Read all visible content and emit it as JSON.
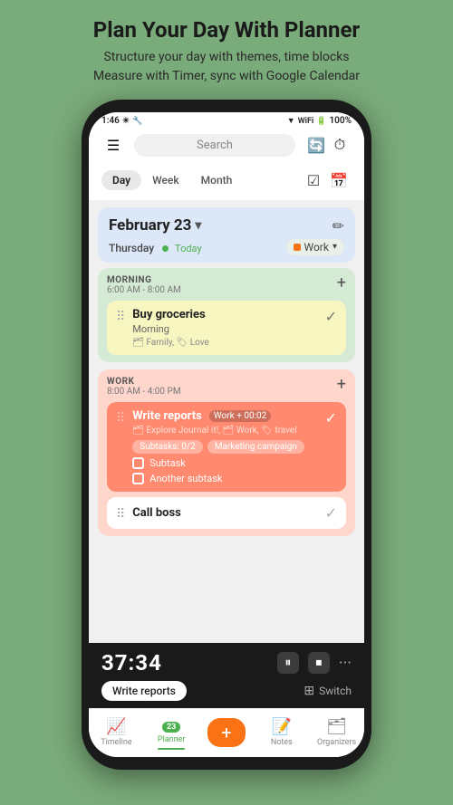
{
  "header": {
    "title": "Plan Your Day With Planner",
    "subtitle_line1": "Structure your day with themes, time blocks",
    "subtitle_line2": "Measure with Timer, sync with Google Calendar"
  },
  "status_bar": {
    "time": "1:46",
    "battery": "100%",
    "signal": "●●●"
  },
  "search": {
    "placeholder": "Search"
  },
  "view_tabs": {
    "day": "Day",
    "week": "Week",
    "month": "Month"
  },
  "date_header": {
    "date": "February 23",
    "day": "Thursday",
    "today_label": "Today",
    "work_label": "Work"
  },
  "morning_section": {
    "title": "MORNING",
    "time": "6:00 AM - 8:00 AM",
    "task": {
      "title": "Buy groceries",
      "sub": "Morning",
      "tags": "🗂 Family, 🏷 Love"
    }
  },
  "work_section": {
    "title": "WORK",
    "time": "8:00 AM - 4:00 PM",
    "task1": {
      "title": "Write reports",
      "sub": "Work",
      "timer_badge": "+ 00:02",
      "tags": "🗂 Explore Journal it!, 🗂 Work, 🏷 travel",
      "subtask_chip1": "Subtasks: 0/2",
      "subtask_chip2": "Marketing campaign",
      "subtask1": "Subtask",
      "subtask2": "Another subtask"
    },
    "task2": {
      "title": "Call boss"
    }
  },
  "timer": {
    "display": "37:34",
    "task_label": "Write reports",
    "switch_label": "Switch"
  },
  "bottom_nav": {
    "timeline": "Timeline",
    "planner": "Planner",
    "create": "+",
    "notes": "Notes",
    "organizers": "Organizers",
    "planner_badge": "23"
  }
}
